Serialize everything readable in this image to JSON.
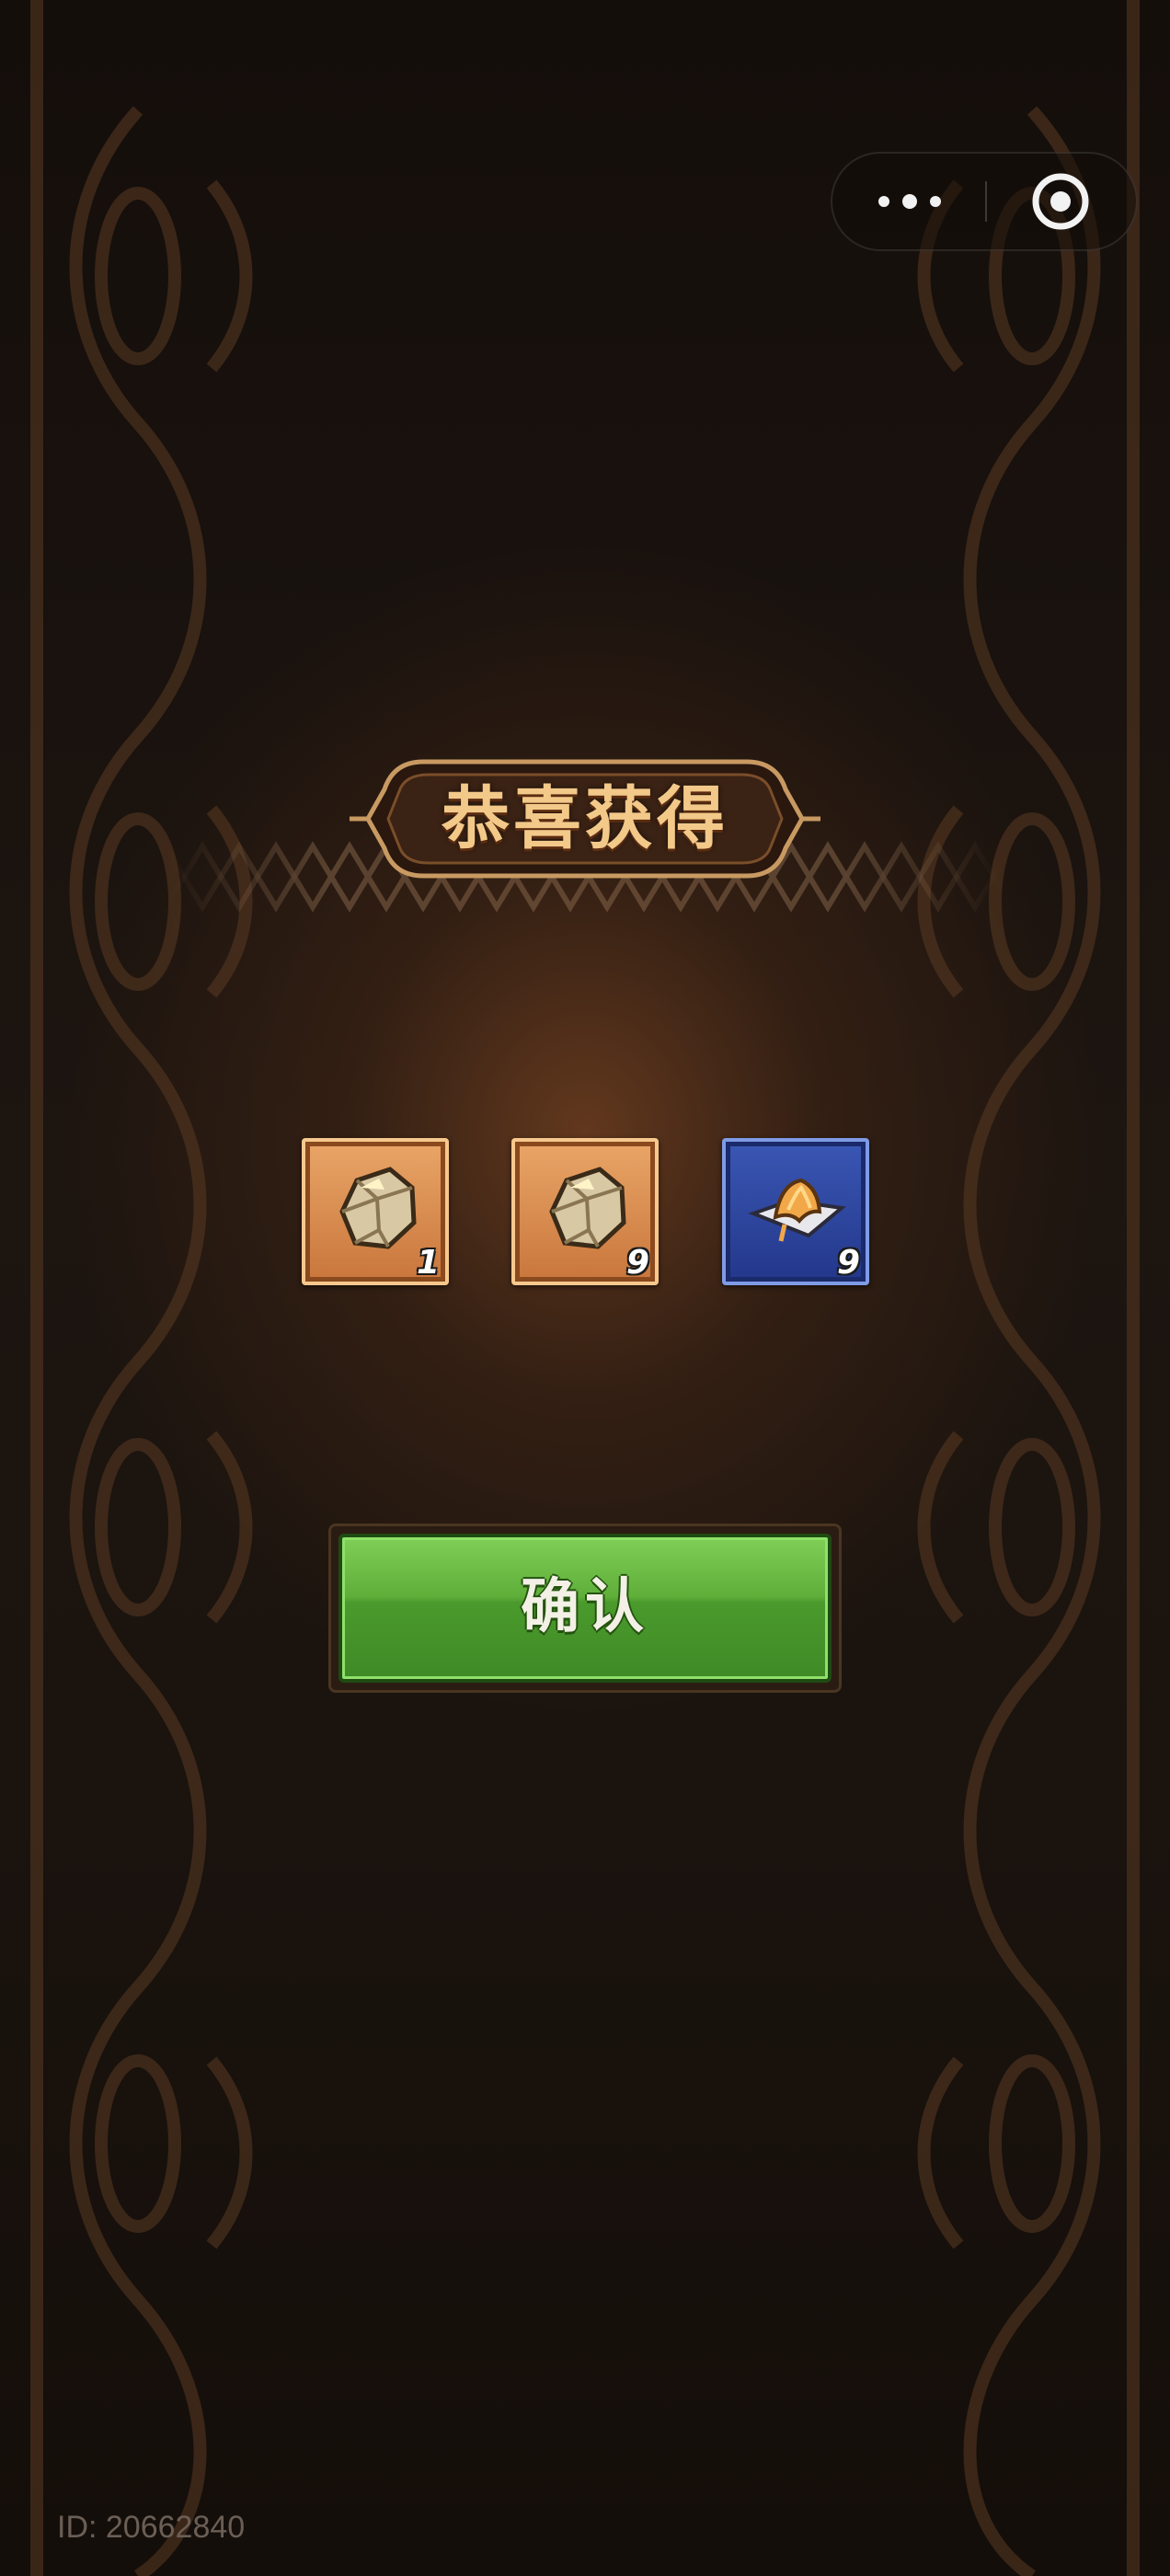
{
  "header": {
    "capsule_icons": [
      "more-dots-icon",
      "close-circle-icon"
    ]
  },
  "dialog": {
    "title": "恭喜获得",
    "rewards": [
      {
        "icon": "ore-rock-icon",
        "rarity": "orange",
        "count": "1"
      },
      {
        "icon": "ore-rock-icon",
        "rarity": "orange",
        "count": "9"
      },
      {
        "icon": "magic-scroll-icon",
        "rarity": "blue",
        "count": "9"
      }
    ],
    "confirm_label": "确认"
  },
  "footer": {
    "id_text": "ID: 20662840"
  },
  "colors": {
    "background": "#1a130e",
    "title_text": "#f3c98a",
    "button_green": "#5fae3a",
    "orange_frame": "#c9763c",
    "blue_frame": "#23378a"
  }
}
